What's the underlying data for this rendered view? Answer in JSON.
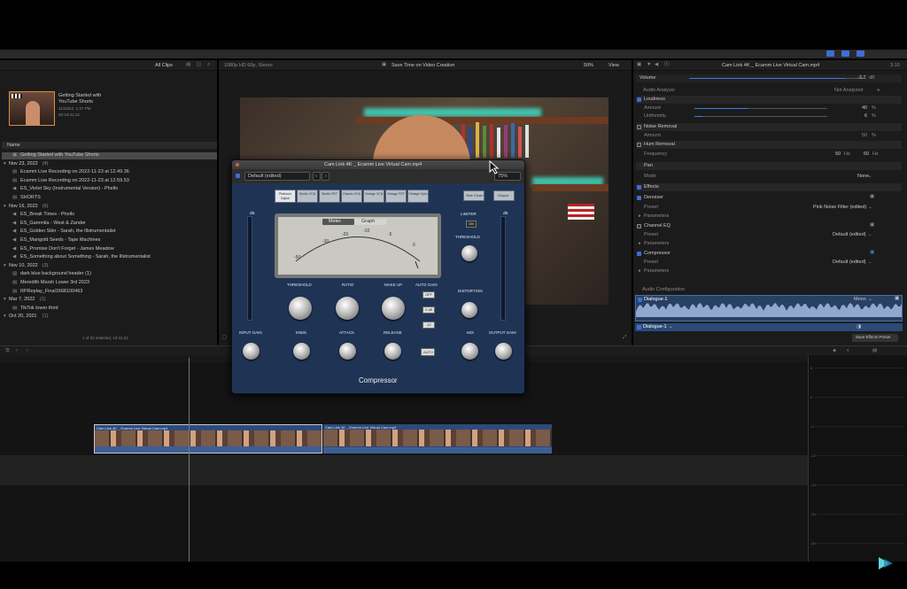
{
  "library": {
    "filter_label": "All Clips",
    "event_title_line1": "Getting Started with",
    "event_title_line2": "YouTube Shorts",
    "event_date": "11/23/22, 1:37 PM",
    "event_duration": "00:13:41;13",
    "name_header": "Name",
    "rows": [
      {
        "label": "Getting Started with YouTube Shorts",
        "kind": "project",
        "selected": true
      },
      {
        "label": "Nov 23, 2022",
        "count": "(4)",
        "kind": "group"
      },
      {
        "label": "Ecamm Live Recording on 2022-11-23 at 12.49.36",
        "kind": "clip"
      },
      {
        "label": "Ecamm Live Recording on 2022-11-23 at 12.59.53",
        "kind": "clip"
      },
      {
        "label": "ES_Violet Sky (Instrumental Version) - Phello",
        "kind": "audio"
      },
      {
        "label": "SHORTS",
        "kind": "clip"
      },
      {
        "label": "Nov 16, 2022",
        "count": "(6)",
        "kind": "group"
      },
      {
        "label": "ES_Break Times - Phello",
        "kind": "audio"
      },
      {
        "label": "ES_Gammila - West & Zander",
        "kind": "audio"
      },
      {
        "label": "ES_Golden Skin - Sarah, the Illstrumentalist",
        "kind": "audio"
      },
      {
        "label": "ES_Marigold Seeds - Tape Machines",
        "kind": "audio"
      },
      {
        "label": "ES_Promise Don't Forget - James Meadow",
        "kind": "audio"
      },
      {
        "label": "ES_Something about Something - Sarah, the Illstrumentalist",
        "kind": "audio"
      },
      {
        "label": "Nov 10, 2022",
        "count": "(3)",
        "kind": "group"
      },
      {
        "label": "dark blue background header (1)",
        "kind": "image"
      },
      {
        "label": "Meredith Marsh Lower 3rd 2023",
        "kind": "clip"
      },
      {
        "label": "RPReplay_Final1668100463",
        "kind": "clip"
      },
      {
        "label": "Mar 7, 2022",
        "count": "(1)",
        "kind": "group"
      },
      {
        "label": "TikTok lower third",
        "kind": "clip"
      },
      {
        "label": "Oct 20, 2021",
        "count": "(1)",
        "kind": "group"
      }
    ],
    "status": "1 of 22 selected, 13:41;12"
  },
  "viewer": {
    "format": "1080p HD 60p, Stereo",
    "title": "Save Time on Video Creation",
    "zoom": "50%",
    "view_label": "View"
  },
  "plugin": {
    "window_title": "Cam Link 4K _ Ecamm Live Virtual Cam.mp4",
    "preset": "Default (edited)",
    "zoom": "75%",
    "modes": [
      "Platinum Digital",
      "Studio VCA",
      "Studio FET",
      "Classic VCA",
      "Vintage VCA",
      "Vintage FET",
      "Vintage Opto"
    ],
    "side_chain": "Side Chain",
    "output": "Output",
    "meter_tab": "Meter",
    "graph_tab": "Graph",
    "meter_scale": [
      "-50",
      "-30",
      "-20",
      "-10",
      "-5",
      "0"
    ],
    "db": "dB",
    "limiter": "LIMITER",
    "limiter_on": "ON",
    "threshold": "THRESHOLD",
    "ratio": "RATIO",
    "makeup": "MAKE UP",
    "auto_gain": "AUTO GAIN",
    "auto_off": "OFF",
    "auto_0db": "0 dB",
    "auto_minus12": "-12",
    "distortion": "DISTORTION",
    "input_gain": "INPUT GAIN",
    "knee": "KNEE",
    "attack": "ATTACK",
    "release": "RELEASE",
    "auto": "AUTO",
    "mix": "MIX",
    "output_gain": "OUTPUT GAIN",
    "name": "Compressor"
  },
  "inspector": {
    "clip_name": "Cam Link 4K _ Ecamm Live Virtual Cam.mp4",
    "clip_duration": "3:10",
    "volume_label": "Volume",
    "volume_value": "-3.7",
    "volume_unit": "dB",
    "audio_analysis": "Audio Analysis",
    "not_analyzed": "Not Analyzed",
    "loudness": "Loudness",
    "amount": "Amount",
    "loudness_amount": "40",
    "loudness_amount_fraction": 0.4,
    "uniformity": "Uniformity",
    "uniformity_value": "6",
    "uniformity_fraction": 0.06,
    "percent": "%",
    "noise_removal": "Noise Removal",
    "noise_amount": "Amount",
    "noise_value": "50",
    "hum_removal": "Hum Removal",
    "frequency": "Frequency",
    "hz50": "50",
    "hz60": "60",
    "hz": "Hz",
    "pan": "Pan",
    "mode": "Mode",
    "mode_value": "None",
    "effects": "Effects",
    "denoiser": "Denoiser",
    "preset": "Preset",
    "denoiser_preset": "Pink Noise Filter (edited)",
    "parameters": "Parameters",
    "channel_eq": "Channel EQ",
    "eq_preset": "Default (edited)",
    "compressor": "Compressor",
    "comp_preset": "Default (edited)",
    "audio_configuration": "Audio Configuration",
    "dialogue1": "Dialogue-1",
    "mono": "Mono",
    "dialogue1b": "Dialogue-1",
    "save_preset": "Save Effects Preset"
  },
  "timeline": {
    "clip1_title": "Cam Link 4K _ Ecamm Live Virtual Cam.mp4",
    "clip2_title": "Cam Link 4K _ Ecamm Live Virtual Cam.mp4",
    "meter_labels": [
      "6",
      "0",
      "-6",
      "-12",
      "-20",
      "-30",
      "-50"
    ]
  },
  "colors": {
    "accent": "#3c6ed8",
    "plugin_bg": "#1f3454",
    "clip_blue": "#2c4a7c"
  }
}
